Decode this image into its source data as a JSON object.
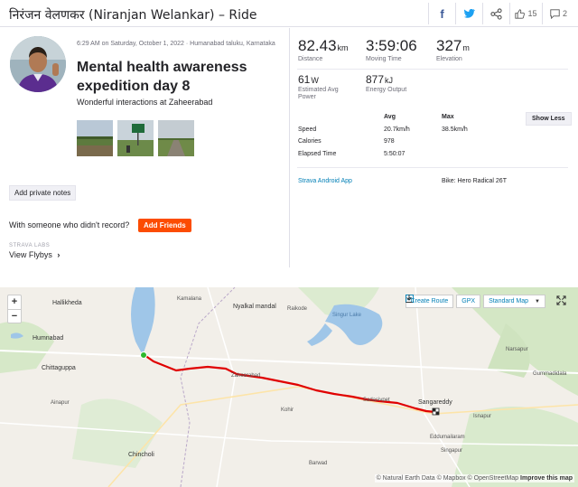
{
  "header": {
    "title": "निरंजन वेलणकर (Niranjan Welankar) – Ride",
    "facebook_icon": "f",
    "kudos_count": "15",
    "comment_count": "2"
  },
  "activity": {
    "meta": "6:29 AM on Saturday, October 1, 2022 · Humanabad taluku, Karnataka",
    "name": "Mental health awareness expedition day 8",
    "description": "Wonderful interactions at Zaheerabad",
    "add_notes_label": "Add private notes",
    "with_someone_text": "With someone who didn't record?",
    "add_friends_label": "Add Friends",
    "labs_label": "STRAVA LABS",
    "flyby_label": "View Flybys"
  },
  "stats": {
    "distance": {
      "value": "82.43",
      "unit": "km",
      "label": "Distance"
    },
    "moving_time": {
      "value": "3:59:06",
      "label": "Moving Time"
    },
    "elevation": {
      "value": "327",
      "unit": "m",
      "label": "Elevation"
    },
    "power": {
      "value": "61",
      "unit": "W",
      "label": "Estimated Avg Power"
    },
    "energy": {
      "value": "877",
      "unit": "kJ",
      "label": "Energy Output"
    }
  },
  "table": {
    "col_avg": "Avg",
    "col_max": "Max",
    "show_less_label": "Show Less",
    "rows": [
      {
        "label": "Speed",
        "avg": "20.7km/h",
        "max": "38.5km/h"
      },
      {
        "label": "Calories",
        "avg": "978",
        "max": ""
      },
      {
        "label": "Elapsed Time",
        "avg": "5:50:07",
        "max": ""
      }
    ]
  },
  "device": "Strava Android App",
  "bike": "Bike: Hero Radical 26T",
  "map": {
    "create_route_label": "Create Route",
    "gpx_label": "GPX",
    "map_type_label": "Standard Map",
    "zoom_in": "+",
    "zoom_out": "−",
    "attribution": "© Natural Earth Data © Mapbox © OpenStreetMap",
    "improve_label": "Improve this map",
    "route_color": "#e00000",
    "water_color": "#9fc6e8",
    "places": [
      "Hallikheda",
      "Kamalana",
      "Nyalkal mandal",
      "Raikode",
      "Singur Lake",
      "Humnabad",
      "Chittaguppa",
      "Zaheerabad",
      "Narsapur",
      "Gummadidala",
      "Sadasivpet",
      "Sangareddy",
      "Kohir",
      "Ainapur",
      "Isnapur",
      "Eddumailaram",
      "Singapur",
      "Chincholi",
      "Barwad"
    ]
  }
}
